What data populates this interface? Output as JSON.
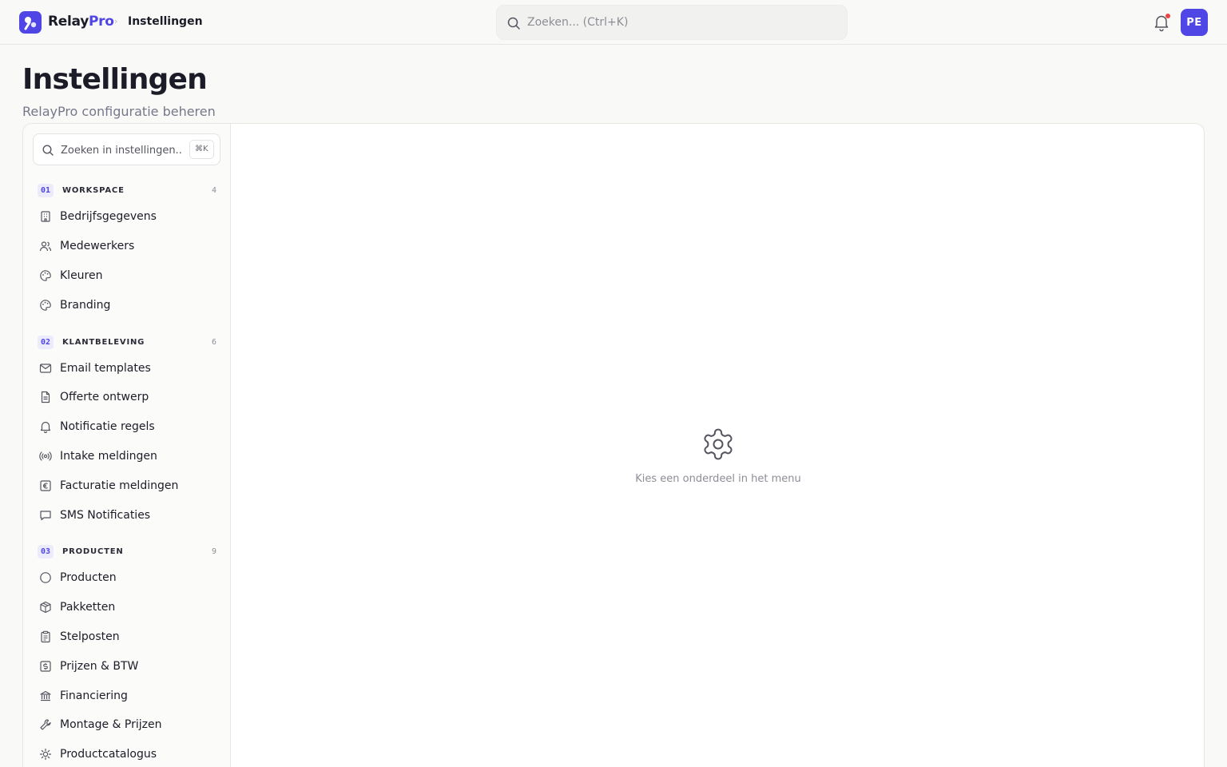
{
  "app": {
    "brand_part1": "Relay",
    "brand_part2": "Pro",
    "breadcrumb_separator": "›",
    "breadcrumb": "Instellingen",
    "avatar_initials": "PE",
    "accent_color": "#4f46e5",
    "notification_dot_color": "#ef4444"
  },
  "search": {
    "placeholder": "Zoeken... (Ctrl+K)"
  },
  "header": {
    "title": "Instellingen",
    "subtitle": "RelayPro configuratie beheren"
  },
  "sidebar": {
    "search_placeholder": "Zoeken in instellingen...",
    "search_shortcut": "⌘K",
    "groups": [
      {
        "number": "01",
        "label": "WORKSPACE",
        "count": "4",
        "items": [
          {
            "label": "Bedrijfsgegevens",
            "icon": "building-icon"
          },
          {
            "label": "Medewerkers",
            "icon": "users-icon"
          },
          {
            "label": "Kleuren",
            "icon": "palette-icon"
          },
          {
            "label": "Branding",
            "icon": "palette-icon"
          }
        ]
      },
      {
        "number": "02",
        "label": "KLANTBELEVING",
        "count": "6",
        "items": [
          {
            "label": "Email templates",
            "icon": "mail-icon"
          },
          {
            "label": "Offerte ontwerp",
            "icon": "file-text-icon"
          },
          {
            "label": "Notificatie regels",
            "icon": "bell-icon"
          },
          {
            "label": "Intake meldingen",
            "icon": "radio-icon"
          },
          {
            "label": "Facturatie meldingen",
            "icon": "euro-icon"
          },
          {
            "label": "SMS Notificaties",
            "icon": "message-icon"
          }
        ]
      },
      {
        "number": "03",
        "label": "PRODUCTEN",
        "count": "9",
        "items": [
          {
            "label": "Producten",
            "icon": "circle-icon"
          },
          {
            "label": "Pakketten",
            "icon": "package-icon"
          },
          {
            "label": "Stelposten",
            "icon": "clipboard-icon"
          },
          {
            "label": "Prijzen & BTW",
            "icon": "dollar-icon"
          },
          {
            "label": "Financiering",
            "icon": "bank-icon"
          },
          {
            "label": "Montage & Prijzen",
            "icon": "wrench-icon"
          },
          {
            "label": "Productcatalogus",
            "icon": "sun-icon"
          }
        ]
      }
    ]
  },
  "content": {
    "empty_state_text": "Kies een onderdeel in het menu",
    "empty_state_icon": "gear-icon"
  }
}
